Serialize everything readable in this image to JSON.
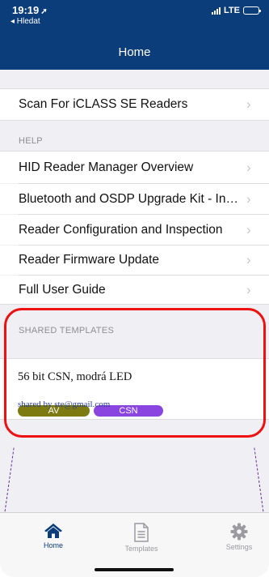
{
  "status": {
    "time": "19:19",
    "back_label": "◂ Hledat",
    "network": "LTE"
  },
  "nav": {
    "title": "Home"
  },
  "scan": {
    "label": "Scan For iCLASS SE Readers"
  },
  "help": {
    "header": "HELP",
    "items": [
      {
        "label": "HID Reader Manager Overview"
      },
      {
        "label": "Bluetooth and OSDP Upgrade Kit - Installation"
      },
      {
        "label": "Reader Configuration and Inspection"
      },
      {
        "label": "Reader Firmware Update"
      },
      {
        "label": "Full User Guide"
      }
    ]
  },
  "templates": {
    "header": "SHARED TEMPLATES",
    "item": {
      "name": "56 bit CSN, modrá LED",
      "tags": [
        {
          "label": "AV",
          "color": "#7d7a12"
        },
        {
          "label": "CSN",
          "color": "#8a45e0"
        }
      ],
      "shared_by": "shared by ste@gmail.com"
    }
  },
  "tabbar": {
    "tabs": [
      {
        "label": "Home",
        "icon": "home-icon",
        "active": true
      },
      {
        "label": "Templates",
        "icon": "document-icon",
        "active": false
      },
      {
        "label": "Settings",
        "icon": "gear-icon",
        "active": false
      }
    ]
  },
  "colors": {
    "nav_bar": "#0c3d7b",
    "highlight": "#ee1111",
    "link": "#2a3e93"
  }
}
